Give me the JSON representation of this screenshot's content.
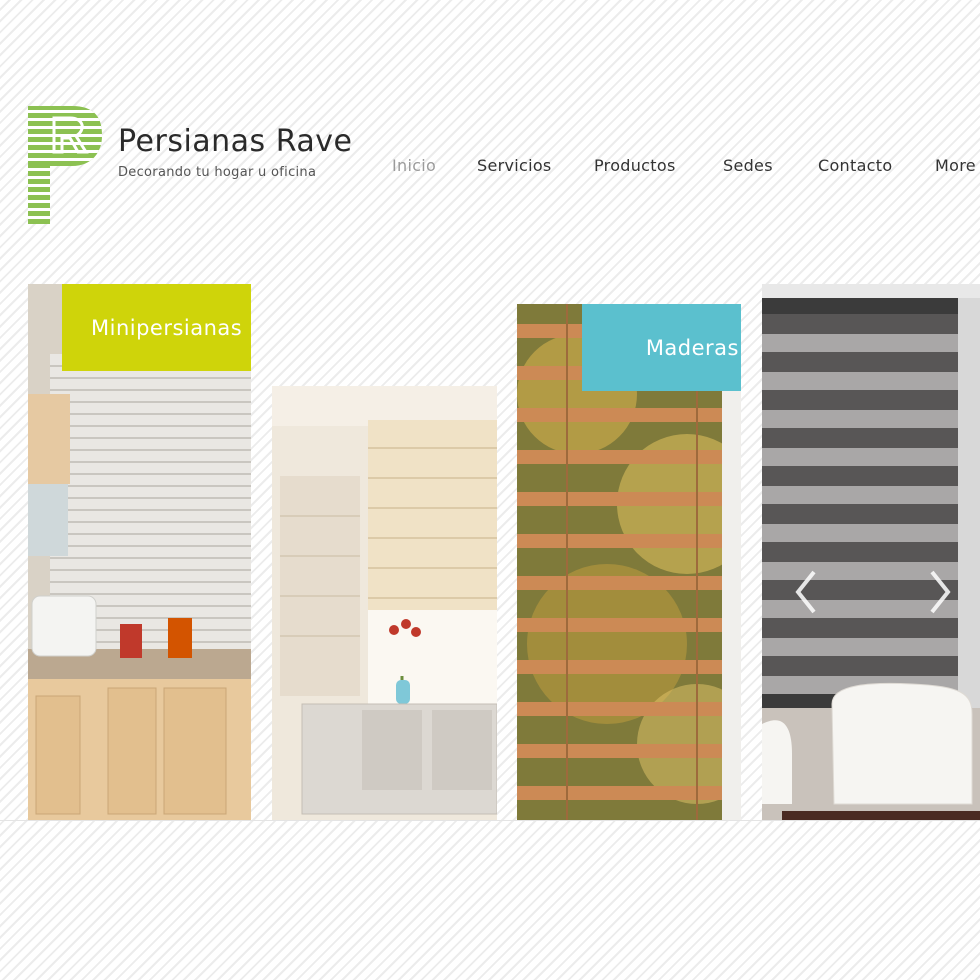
{
  "brand": {
    "name": "Persianas Rave",
    "tagline": "Decorando tu hogar u oficina",
    "logo_icon": "striped-letter-pr-logo",
    "logo_color": "#8cc152"
  },
  "nav": {
    "items": [
      {
        "label": "Inicio",
        "active": true
      },
      {
        "label": "Servicios",
        "active": false
      },
      {
        "label": "Productos",
        "active": false
      },
      {
        "label": "Sedes",
        "active": false
      },
      {
        "label": "Contacto",
        "active": false
      },
      {
        "label": "More",
        "active": false
      }
    ]
  },
  "gallery": {
    "panels": [
      {
        "label": "Minipersianas",
        "label_color": "#cfd40a",
        "image": "kitchen-with-mini-blinds"
      },
      {
        "label": "",
        "image": "roman-shade-room"
      },
      {
        "label": "Maderas",
        "label_color": "#5bc0ce",
        "image": "wooden-blinds"
      },
      {
        "label": "",
        "image": "zebra-roller-blind-living-room"
      }
    ],
    "prev_icon": "chevron-left-icon",
    "next_icon": "chevron-right-icon"
  }
}
